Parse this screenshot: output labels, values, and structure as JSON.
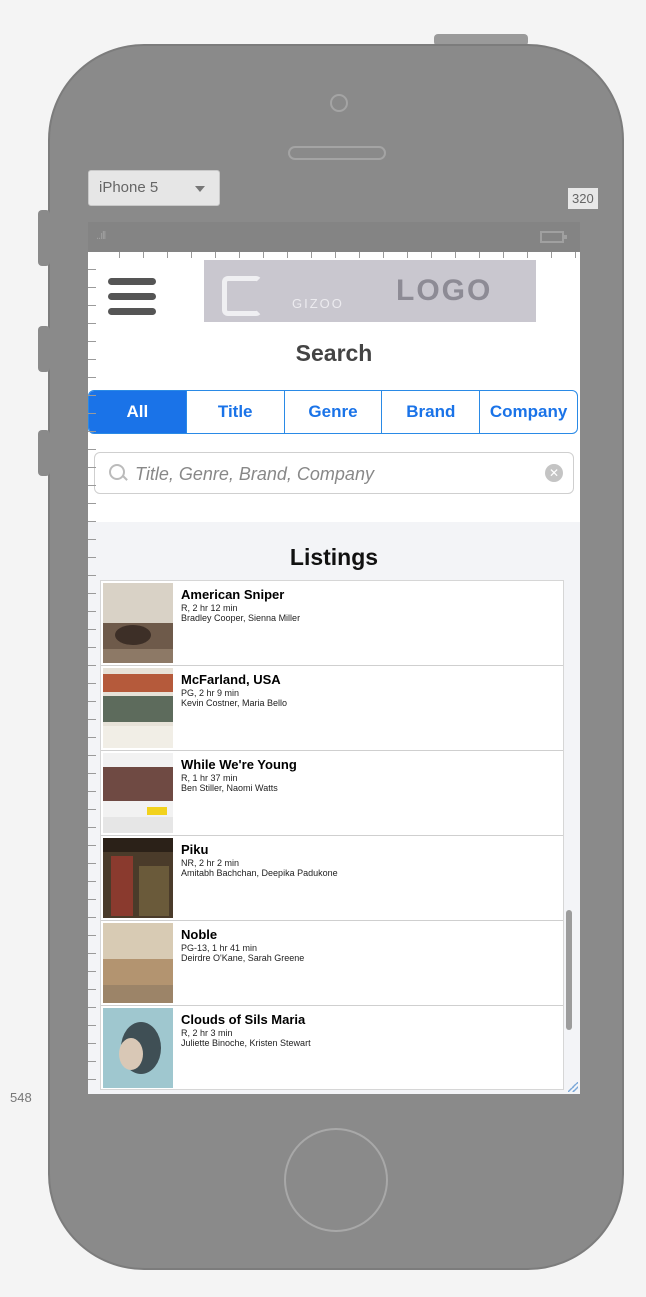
{
  "device": {
    "selector_label": "iPhone 5",
    "width_label": "320",
    "height_label": "548",
    "signal": "..ıll"
  },
  "header": {
    "logo_brand": "GIZOO",
    "logo_text": "LOGO"
  },
  "search": {
    "title": "Search",
    "segments": [
      "All",
      "Title",
      "Genre",
      "Brand",
      "Company"
    ],
    "active_segment": "All",
    "placeholder": "Title, Genre, Brand, Company"
  },
  "listings": {
    "title": "Listings",
    "items": [
      {
        "title": "American Sniper",
        "meta": "R, 2 hr 12 min",
        "cast": "Bradley Cooper, Sienna Miller"
      },
      {
        "title": "McFarland, USA",
        "meta": "PG, 2 hr 9 min",
        "cast": "Kevin Costner, Maria Bello"
      },
      {
        "title": "While We're Young",
        "meta": "R, 1 hr 37 min",
        "cast": "Ben Stiller, Naomi Watts"
      },
      {
        "title": "Piku",
        "meta": "NR, 2 hr 2 min",
        "cast": "Amitabh Bachchan, Deepika Padukone"
      },
      {
        "title": "Noble",
        "meta": "PG-13, 1 hr 41 min",
        "cast": "Deirdre O'Kane, Sarah Greene"
      },
      {
        "title": "Clouds of Sils Maria",
        "meta": "R, 2 hr 3 min",
        "cast": "Juliette Binoche, Kristen Stewart"
      }
    ]
  },
  "colors": {
    "accent": "#1a73e8",
    "phone_body": "#8a8a8a",
    "listings_bg": "#f3f4f7"
  }
}
